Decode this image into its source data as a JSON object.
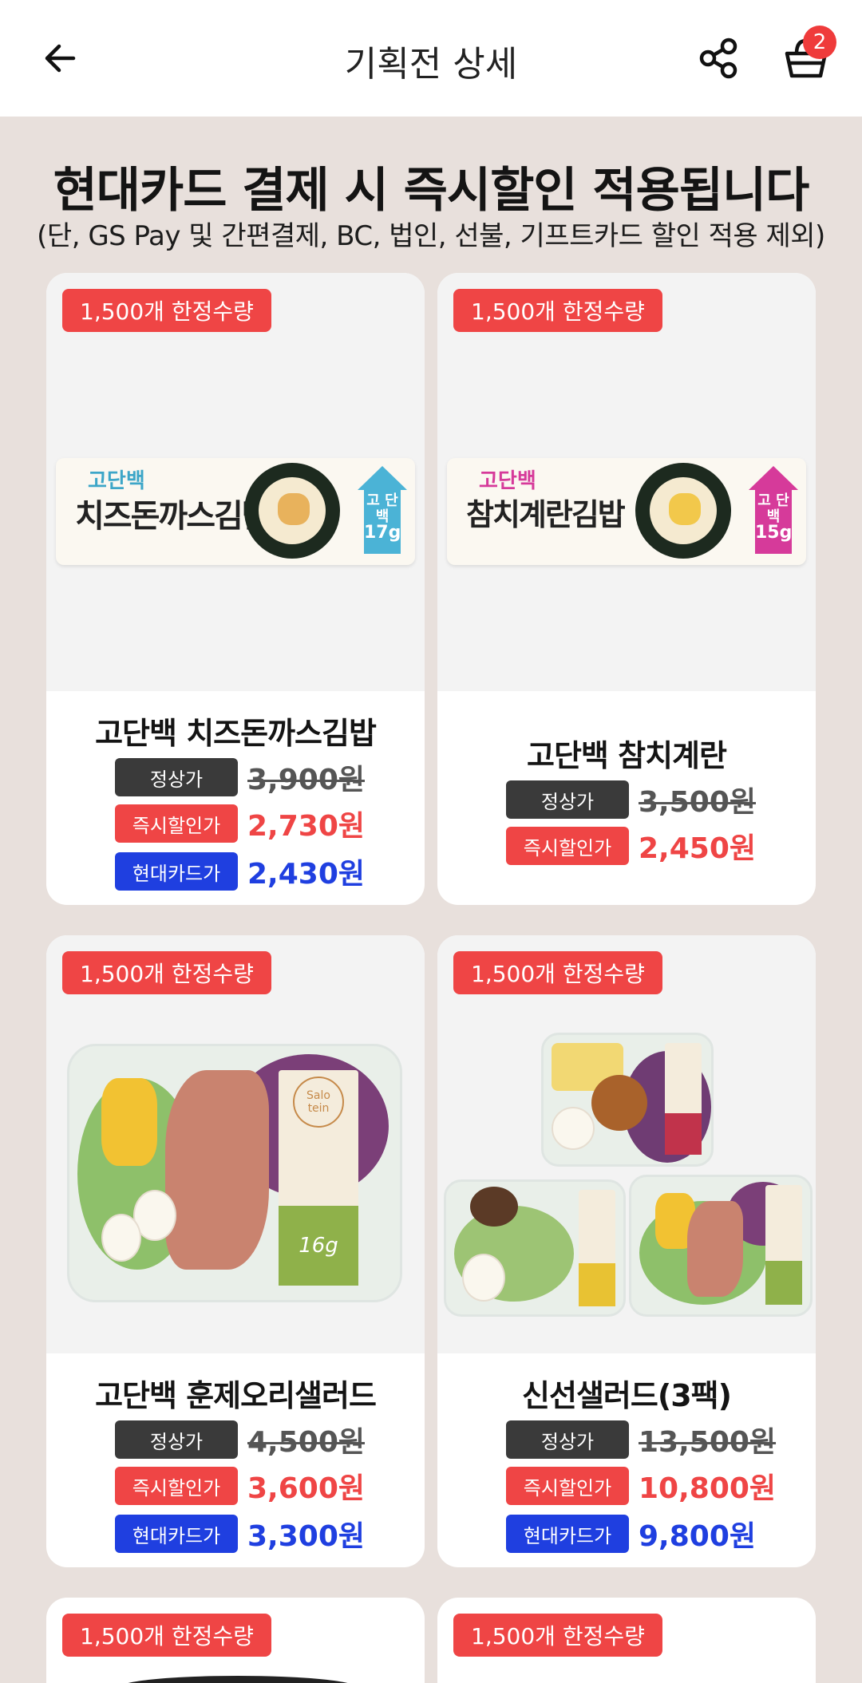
{
  "header": {
    "title": "기획전 상세",
    "cart_count": "2"
  },
  "promo": {
    "headline": "현대카드 결제 시 즉시할인 적용됩니다",
    "subtext": "(단, GS Pay 및 간편결제, BC, 법인, 선불, 기프트카드 할인 적용 제외)"
  },
  "price_labels": {
    "regular": "정상가",
    "instant": "즉시할인가",
    "hyundai": "현대카드가"
  },
  "products": [
    {
      "badge": "1,500개 한정수량",
      "name": "고단백 치즈돈까스김밥",
      "regular_price": "3,900원",
      "instant_price": "2,730원",
      "hyundai_price": "2,430원"
    },
    {
      "badge": "1,500개 한정수량",
      "name": "고단백 참치계란",
      "regular_price": "3,500원",
      "instant_price": "2,450원"
    },
    {
      "badge": "1,500개 한정수량",
      "name": "고단백 훈제오리샐러드",
      "regular_price": "4,500원",
      "instant_price": "3,600원",
      "hyundai_price": "3,300원"
    },
    {
      "badge": "1,500개 한정수량",
      "name": "신선샐러드(3팩)",
      "regular_price": "13,500원",
      "instant_price": "10,800원",
      "hyundai_price": "9,800원"
    },
    {
      "badge": "1,500개 한정수량"
    },
    {
      "badge": "1,500개 한정수량"
    }
  ],
  "packaging": {
    "cheese_brand": "고단백",
    "cheese_name": "치즈돈까스김밥",
    "tuna_brand": "고단백",
    "tuna_name": "참치계란김밥",
    "protein_word": "고 단백",
    "cheese_protein": "17g",
    "tuna_protein": "15g",
    "salad_logo": "Salo tein",
    "duck_protein": "16g"
  },
  "colors": {
    "accent_red": "#ef4545",
    "hyundai_blue": "#1f3fe0",
    "regular_gray": "#3a3a3a",
    "background": "#e8e0dc"
  }
}
